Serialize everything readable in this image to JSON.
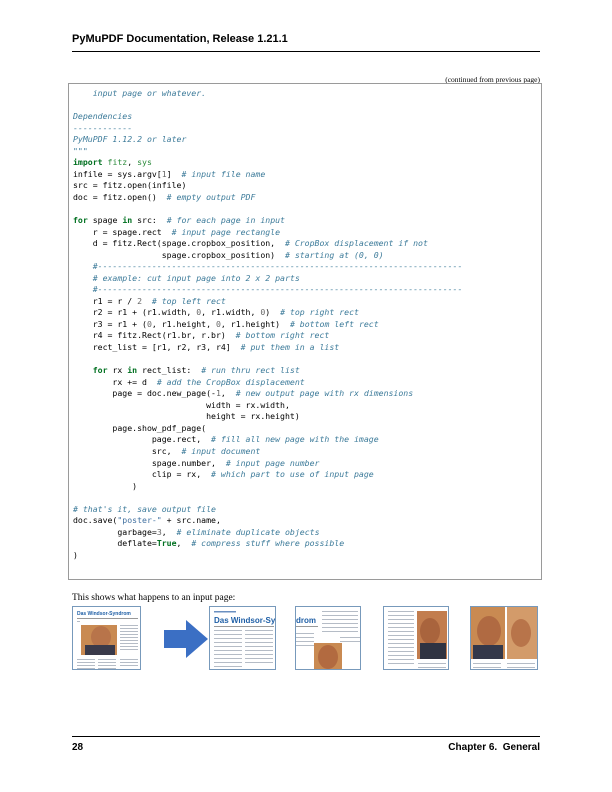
{
  "header": {
    "title": "PyMuPDF Documentation, Release 1.21.1"
  },
  "continued_note": "(continued from previous page)",
  "code_lines": [
    [
      [
        "    input page or whatever.",
        "c"
      ]
    ],
    [
      [
        "",
        ""
      ]
    ],
    [
      [
        "Dependencies",
        "c"
      ]
    ],
    [
      [
        "------------",
        "c"
      ]
    ],
    [
      [
        "PyMuPDF 1.12.2 or later",
        "c"
      ]
    ],
    [
      [
        "\"\"\"",
        "c"
      ]
    ],
    [
      [
        "import",
        "k"
      ],
      [
        " ",
        ""
      ],
      [
        "fitz",
        "n"
      ],
      [
        ", ",
        ""
      ],
      [
        "sys",
        "n"
      ]
    ],
    [
      [
        "infile = sys.argv[",
        ""
      ],
      [
        "1",
        "o"
      ],
      [
        "]  ",
        ""
      ],
      [
        "# input file name",
        "c"
      ]
    ],
    [
      [
        "src = fitz.open(infile)",
        ""
      ]
    ],
    [
      [
        "doc = fitz.open()  ",
        ""
      ],
      [
        "# empty output PDF",
        "c"
      ]
    ],
    [
      [
        "",
        ""
      ]
    ],
    [
      [
        "for",
        "k"
      ],
      [
        " spage ",
        ""
      ],
      [
        "in",
        "k"
      ],
      [
        " src:  ",
        ""
      ],
      [
        "# for each page in input",
        "c"
      ]
    ],
    [
      [
        "    r = spage.rect  ",
        ""
      ],
      [
        "# input page rectangle",
        "c"
      ]
    ],
    [
      [
        "    d = fitz.Rect(spage.cropbox_position,  ",
        ""
      ],
      [
        "# CropBox displacement if not",
        "c"
      ]
    ],
    [
      [
        "                  spage.cropbox_position)  ",
        ""
      ],
      [
        "# starting at (0, 0)",
        "c"
      ]
    ],
    [
      [
        "    #--------------------------------------------------------------------------",
        "c"
      ]
    ],
    [
      [
        "    # example: cut input page into 2 x 2 parts",
        "c"
      ]
    ],
    [
      [
        "    #--------------------------------------------------------------------------",
        "c"
      ]
    ],
    [
      [
        "    r1 = r / ",
        ""
      ],
      [
        "2",
        "o"
      ],
      [
        "  ",
        ""
      ],
      [
        "# top left rect",
        "c"
      ]
    ],
    [
      [
        "    r2 = r1 + (r1.width, ",
        ""
      ],
      [
        "0",
        "o"
      ],
      [
        ", r1.width, ",
        ""
      ],
      [
        "0",
        "o"
      ],
      [
        ")  ",
        ""
      ],
      [
        "# top right rect",
        "c"
      ]
    ],
    [
      [
        "    r3 = r1 + (",
        ""
      ],
      [
        "0",
        "o"
      ],
      [
        ", r1.height, ",
        ""
      ],
      [
        "0",
        "o"
      ],
      [
        ", r1.height)  ",
        ""
      ],
      [
        "# bottom left rect",
        "c"
      ]
    ],
    [
      [
        "    r4 = fitz.Rect(r1.br, r.br)  ",
        ""
      ],
      [
        "# bottom right rect",
        "c"
      ]
    ],
    [
      [
        "    rect_list = [r1, r2, r3, r4]  ",
        ""
      ],
      [
        "# put them in a list",
        "c"
      ]
    ],
    [
      [
        "",
        ""
      ]
    ],
    [
      [
        "    ",
        ""
      ],
      [
        "for",
        "k"
      ],
      [
        " rx ",
        ""
      ],
      [
        "in",
        "k"
      ],
      [
        " rect_list:  ",
        ""
      ],
      [
        "# run thru rect list",
        "c"
      ]
    ],
    [
      [
        "        rx += d  ",
        ""
      ],
      [
        "# add the CropBox displacement",
        "c"
      ]
    ],
    [
      [
        "        page = doc.new_page(-",
        ""
      ],
      [
        "1",
        "o"
      ],
      [
        ",  ",
        ""
      ],
      [
        "# new output page with rx dimensions",
        "c"
      ]
    ],
    [
      [
        "                           width = rx.width,",
        ""
      ]
    ],
    [
      [
        "                           height = rx.height)",
        ""
      ]
    ],
    [
      [
        "        page.show_pdf_page(",
        ""
      ]
    ],
    [
      [
        "                page.rect,  ",
        ""
      ],
      [
        "# fill all new page with the image",
        "c"
      ]
    ],
    [
      [
        "                src,  ",
        ""
      ],
      [
        "# input document",
        "c"
      ]
    ],
    [
      [
        "                spage.number,  ",
        ""
      ],
      [
        "# input page number",
        "c"
      ]
    ],
    [
      [
        "                clip = rx,  ",
        ""
      ],
      [
        "# which part to use of input page",
        "c"
      ]
    ],
    [
      [
        "            )",
        ""
      ]
    ],
    [
      [
        "",
        ""
      ]
    ],
    [
      [
        "# that's it, save output file",
        "c"
      ]
    ],
    [
      [
        "doc.save(",
        ""
      ],
      [
        "\"poster-\"",
        "s"
      ],
      [
        " + src.name,",
        ""
      ]
    ],
    [
      [
        "         garbage=",
        ""
      ],
      [
        "3",
        "o"
      ],
      [
        ",  ",
        ""
      ],
      [
        "# eliminate duplicate objects",
        "c"
      ]
    ],
    [
      [
        "         deflate=",
        ""
      ],
      [
        "True",
        "kc"
      ],
      [
        ",  ",
        ""
      ],
      [
        "# compress stuff where possible",
        "c"
      ]
    ],
    [
      [
        ")",
        ""
      ]
    ]
  ],
  "body_text": "This shows what happens to an input page:",
  "thumbnails": {
    "input_title": "Das Windsor-Syndrom",
    "output_title": "Das Windsor-Synd",
    "output_title_part": "drom"
  },
  "footer": {
    "page_number": "28",
    "chapter": "Chapter 6.  General"
  }
}
